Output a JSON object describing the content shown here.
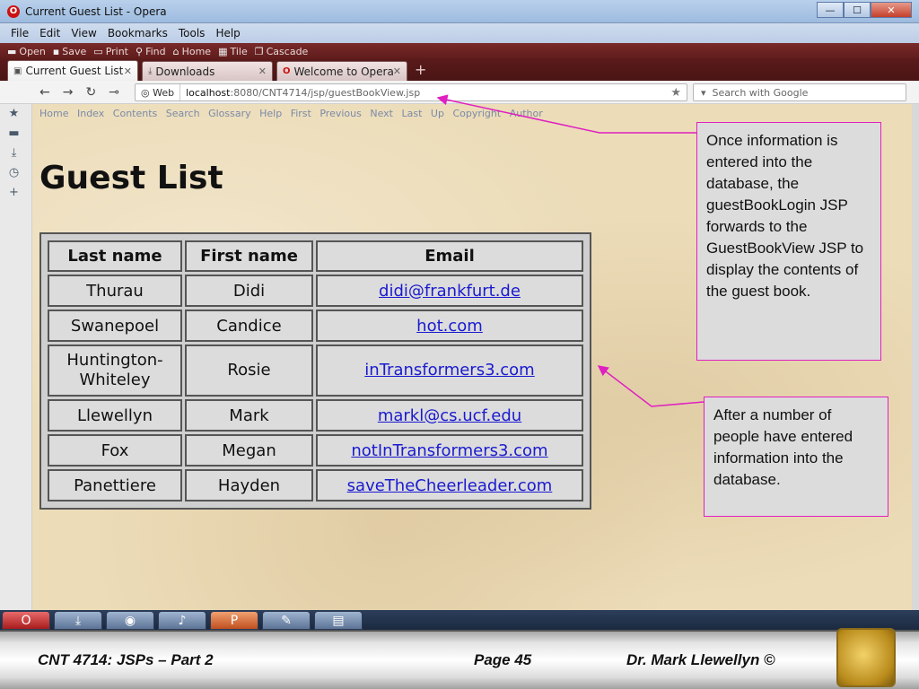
{
  "window": {
    "title": "Current Guest List - Opera",
    "controls": {
      "minimize": "—",
      "maximize": "☐",
      "close": "✕"
    }
  },
  "menu": [
    "File",
    "Edit",
    "View",
    "Bookmarks",
    "Tools",
    "Help"
  ],
  "toolbar": [
    "Open",
    "Save",
    "Print",
    "Find",
    "Home",
    "Tile",
    "Cascade"
  ],
  "tabs": [
    {
      "label": "Current Guest List",
      "icon": "page-icon",
      "active": true
    },
    {
      "label": "Downloads",
      "icon": "download-icon",
      "active": false
    },
    {
      "label": "Welcome to Opera",
      "icon": "opera-icon",
      "active": false
    }
  ],
  "address": {
    "badge": "Web",
    "host": "localhost",
    "path": ":8080/CNT4714/jsp/guestBookView.jsp",
    "search_placeholder": "Search with Google"
  },
  "navlinks": [
    "Home",
    "Index",
    "Contents",
    "Search",
    "Glossary",
    "Help",
    "First",
    "Previous",
    "Next",
    "Last",
    "Up",
    "Copyright",
    "Author"
  ],
  "page": {
    "heading": "Guest List",
    "columns": [
      "Last name",
      "First name",
      "Email"
    ],
    "rows": [
      {
        "last": "Thurau",
        "first": "Didi",
        "email": "didi@frankfurt.de"
      },
      {
        "last": "Swanepoel",
        "first": "Candice",
        "email": "hot.com"
      },
      {
        "last": "Huntington-Whiteley",
        "first": "Rosie",
        "email": "inTransformers3.com"
      },
      {
        "last": "Llewellyn",
        "first": "Mark",
        "email": "markl@cs.ucf.edu"
      },
      {
        "last": "Fox",
        "first": "Megan",
        "email": "notInTransformers3.com"
      },
      {
        "last": "Panettiere",
        "first": "Hayden",
        "email": "saveTheCheerleader.com"
      }
    ]
  },
  "notes": {
    "note1": "Once information is entered into the database, the guestBookLogin JSP forwards to the GuestBookView JSP to display the contents of the guest book.",
    "note2": "After a number of people have entered information into the database."
  },
  "footer": {
    "course": "CNT 4714: JSPs – Part 2",
    "page": "Page 45",
    "author": "Dr. Mark Llewellyn ©"
  },
  "colors": {
    "annotation_border": "#e020c0",
    "link": "#1a1ad0",
    "browser_chrome": "#6b1f1f"
  }
}
